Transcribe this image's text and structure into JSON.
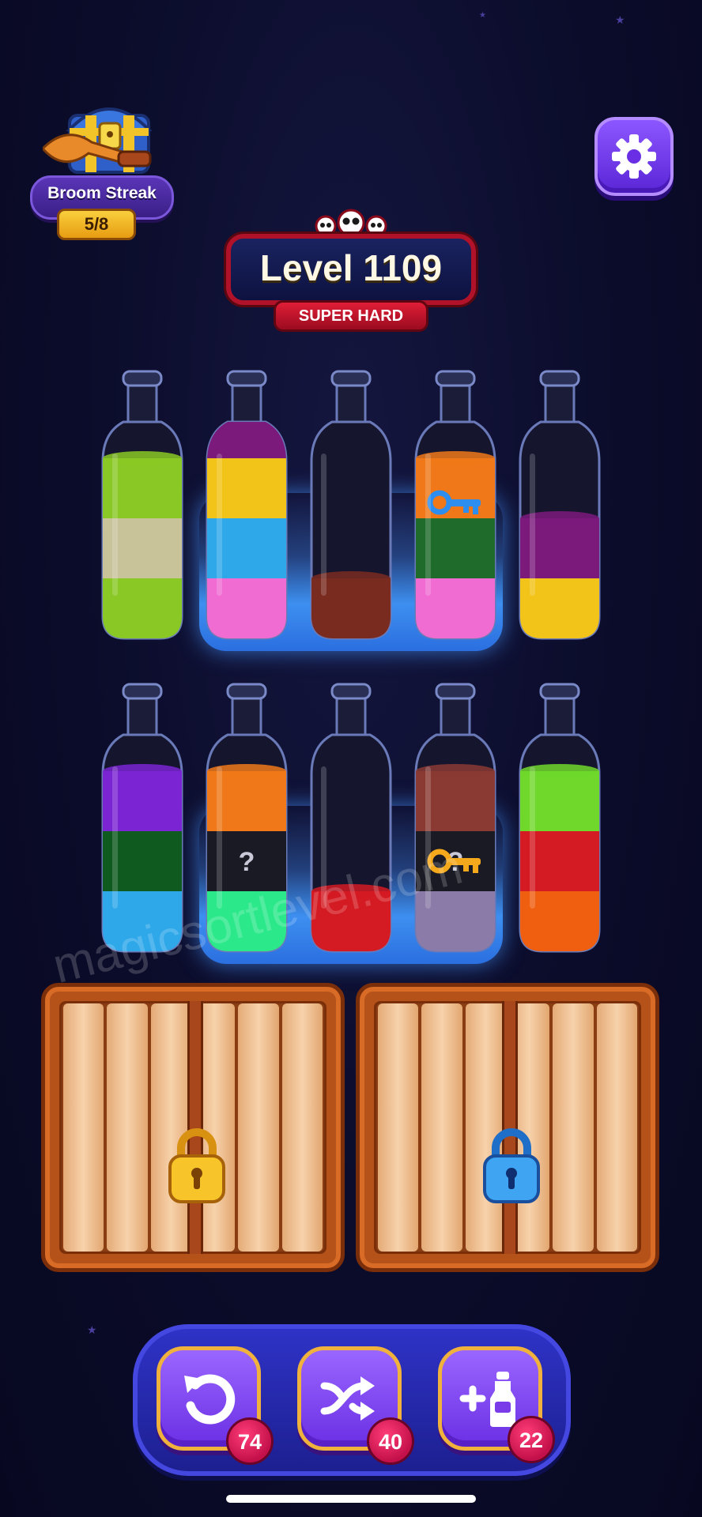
{
  "broom_streak": {
    "label": "Broom Streak",
    "progress": "5/8",
    "icon": "treasure-chest-broom-icon"
  },
  "settings": {
    "icon": "gear-icon"
  },
  "level": {
    "title": "Level 1109",
    "difficulty": "SUPER HARD",
    "icon": "skulls-icon"
  },
  "rows": [
    [
      {
        "frozen": false,
        "layers": [
          "#8ac925",
          "#c9c39a",
          "#8ac925"
        ]
      },
      {
        "frozen": true,
        "layers": [
          "#f06cd2",
          "#2fa8ea",
          "#f2c318",
          "#7c1a7c"
        ]
      },
      {
        "frozen": true,
        "layers": [
          "#7a2b20"
        ]
      },
      {
        "frozen": true,
        "key": "blue",
        "layers": [
          "#f06cd2",
          "#1e6b2c",
          "#f07818"
        ]
      },
      {
        "frozen": false,
        "layers": [
          "#f2c318",
          "#7c1a7c"
        ]
      }
    ],
    [
      {
        "frozen": false,
        "layers": [
          "#2fa8ea",
          "#0f5a1e",
          "#7a24d4"
        ]
      },
      {
        "frozen": true,
        "layers": [
          "#2be88a",
          "#1a1a24",
          "#f07818"
        ],
        "hidden": [
          false,
          true,
          false
        ]
      },
      {
        "frozen": true,
        "layers": [
          "#d41a22"
        ]
      },
      {
        "frozen": true,
        "key": "gold",
        "layers": [
          "#8a7ba8",
          "#1a1a24",
          "#8a3a32"
        ],
        "hidden": [
          false,
          true,
          false
        ]
      },
      {
        "frozen": false,
        "layers": [
          "#f05f10",
          "#d41a22",
          "#6fd82a"
        ]
      }
    ]
  ],
  "crates": [
    {
      "lock": "gold"
    },
    {
      "lock": "blue"
    }
  ],
  "watermark": "magicsortlevel.com",
  "boosters": [
    {
      "name": "undo",
      "icon": "undo-icon",
      "count": "74"
    },
    {
      "name": "shuffle",
      "icon": "shuffle-icon",
      "count": "40"
    },
    {
      "name": "add-bottle",
      "icon": "add-bottle-icon",
      "count": "22"
    }
  ]
}
